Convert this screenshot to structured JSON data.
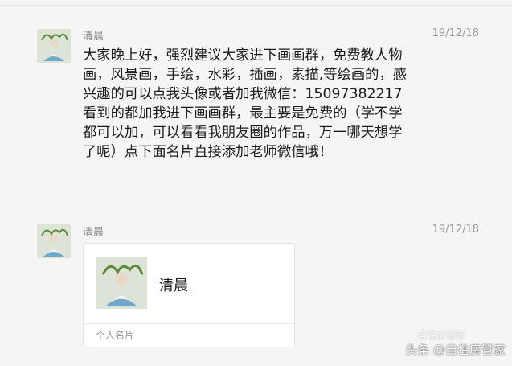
{
  "messages": [
    {
      "name": "清晨",
      "time": "19/12/18",
      "paragraphs": [
        "大家晚上好，强烈建议大家进下画画群，免费教人物画，风景画，手绘，水彩，插画，素描,等绘画的，感兴趣的可以点我头像或者加我微信：15097382217",
        "看到的都加我进下画画群，最主要是免费的（学不学都可以加，可以看看我朋友圈的作品，万一哪天想学了呢）点下面名片直接添加老师微信哦！"
      ]
    },
    {
      "name": "清晨",
      "time": "19/12/18",
      "card": {
        "name": "清晨",
        "type": "个人名片"
      }
    }
  ],
  "watermark": {
    "text": "头条 @自住房管家",
    "ghost_text": "自住房管家"
  },
  "colors": {
    "background": "#f5f5f5",
    "text": "#1a1a1a",
    "meta": "#8a8a8a",
    "card": "#ffffff"
  },
  "icons": [
    "avatar-image",
    "card-avatar-image"
  ]
}
